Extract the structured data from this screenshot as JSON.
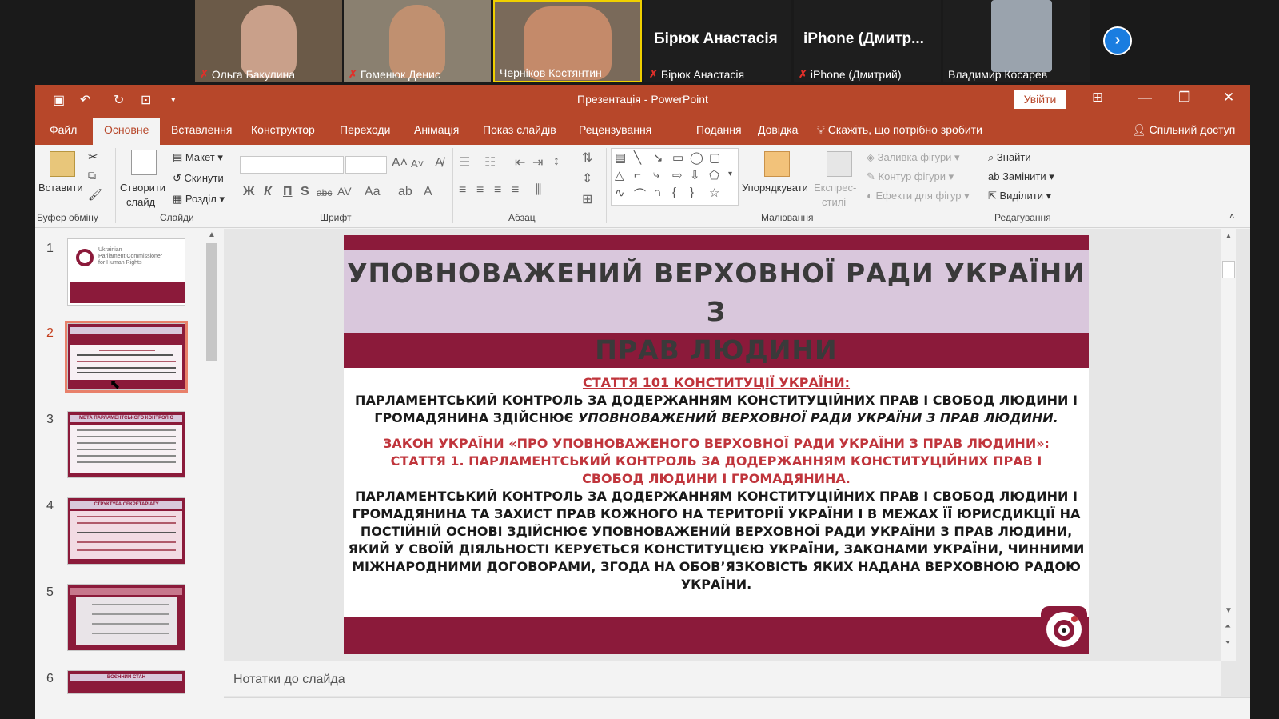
{
  "participants": [
    {
      "name": "Ольга Бакулина",
      "muted": true
    },
    {
      "name": "Гоменюк Денис",
      "muted": true
    },
    {
      "name": "Черніков Костянтин",
      "muted": false
    },
    {
      "name": "Бірюк Анастасія",
      "muted": true,
      "display": "Бірюк Анастасія"
    },
    {
      "name": "iPhone (Дмитрий)",
      "muted": true,
      "display": "iPhone (Дмитр..."
    },
    {
      "name": "Владимир Косарев",
      "muted": false
    }
  ],
  "app": {
    "title": "Презентація  -  PowerPoint",
    "signin": "Увійти",
    "icons": {
      "save": "save-icon",
      "undo": "undo-icon",
      "redo": "redo-icon",
      "present": "present-icon",
      "customize": "customize-icon"
    }
  },
  "tabs": [
    "Файл",
    "Основне",
    "Вставлення",
    "Конструктор",
    "Переходи",
    "Анімація",
    "Показ слайдів",
    "Рецензування",
    "Подання",
    "Довідка"
  ],
  "active_tab": "Основне",
  "tell_me": "Скажіть, що потрібно зробити",
  "share": "Спільний доступ",
  "ribbon": {
    "paste": "Вставити",
    "clipboard": "Буфер обміну",
    "new_slide": "Створити",
    "new_slide_2": "слайд",
    "layout": "Макет",
    "reset": "Скинути",
    "section": "Розділ",
    "slides": "Слайди",
    "font": "Шрифт",
    "paragraph": "Абзац",
    "arrange": "Упорядкувати",
    "quick_styles": "Експрес-",
    "quick_styles_2": "стилі",
    "shape_fill": "Заливка фігури",
    "shape_outline": "Контур фігури",
    "shape_effects": "Ефекти для фігур",
    "drawing": "Малювання",
    "find": "Знайти",
    "replace": "Замінити",
    "select": "Виділити",
    "editing": "Редагування",
    "font_buttons": [
      "Ж",
      "К",
      "П",
      "S",
      "abc",
      "AV",
      "Aa"
    ]
  },
  "thumbnails": [
    {
      "num": "1",
      "text_top": "Ukrainian",
      "text_2": "Parliament Commissioner",
      "text_3": "for Human Rights"
    },
    {
      "num": "2"
    },
    {
      "num": "3",
      "text_top": "МЕТА ПАРЛАМЕНТСЬКОГО КОНТРОЛЮ"
    },
    {
      "num": "4",
      "text_top": "СТРУКТУРА СЕКРЕТАРІАТУ"
    },
    {
      "num": "5"
    },
    {
      "num": "6",
      "text_top": "ВОЄННИЙ СТАН"
    }
  ],
  "selected_slide": "2",
  "slide": {
    "title_line1": "УПОВНОВАЖЕНИЙ ВЕРХОВНОЇ РАДИ УКРАЇНИ З",
    "title_line2": "ПРАВ ЛЮДИНИ",
    "heading1": "СТАТТЯ 101 КОНСТИТУЦІЇ УКРАЇНИ:",
    "p1_line1": "ПАРЛАМЕНТСЬКИЙ КОНТРОЛЬ ЗА ДОДЕРЖАННЯМ  КОНСТИТУЦІЙНИХ ПРАВ І СВОБОД ЛЮДИНИ І",
    "p1_line2a": "ГРОМАДЯНИНА ЗДІЙСНЮЄ ",
    "p1_line2b": "УПОВНОВАЖЕНИЙ ВЕРХОВНОЇ РАДИ УКРАЇНИ З ПРАВ ЛЮДИНИ.",
    "heading2": "ЗАКОН УКРАЇНИ «ПРО УПОВНОВАЖЕНОГО ВЕРХОВНОЇ РАДИ УКРАЇНИ З ПРАВ ЛЮДИНИ»:",
    "sub2_line1": "СТАТТЯ 1. ПАРЛАМЕНТСЬКИЙ КОНТРОЛЬ ЗА ДОДЕРЖАННЯМ КОНСТИТУЦІЙНИХ ПРАВ І",
    "sub2_line2": "СВОБОД ЛЮДИНИ І ГРОМАДЯНИНА.",
    "p2": [
      "ПАРЛАМЕНТСЬКИЙ КОНТРОЛЬ ЗА ДОДЕРЖАННЯМ КОНСТИТУЦІЙНИХ ПРАВ І СВОБОД ЛЮДИНИ І",
      "ГРОМАДЯНИНА ТА ЗАХИСТ ПРАВ КОЖНОГО НА ТЕРИТОРІЇ УКРАЇНИ І В МЕЖАХ ЇЇ ЮРИСДИКЦІЇ НА",
      "ПОСТІЙНІЙ ОСНОВІ ЗДІЙСНЮЄ УПОВНОВАЖЕНИЙ ВЕРХОВНОЇ РАДИ УКРАЇНИ З ПРАВ ЛЮДИНИ,",
      "ЯКИЙ У СВОЇЙ ДІЯЛЬНОСТІ КЕРУЄТЬСЯ КОНСТИТУЦІЄЮ УКРАЇНИ, ЗАКОНАМИ УКРАЇНИ, ЧИННИМИ",
      "МІЖНАРОДНИМИ ДОГОВОРАМИ, ЗГОДА НА ОБОВ’ЯЗКОВІСТЬ ЯКИХ НАДАНА ВЕРХОВНОЮ РАДОЮ",
      "УКРАЇНИ."
    ]
  },
  "notes_placeholder": "Нотатки до слайда",
  "colors": {
    "accent": "#b7472a",
    "slide_bg": "#8b1a3a",
    "title_band": "#d9c7dc",
    "heading_red": "#c0353c"
  }
}
